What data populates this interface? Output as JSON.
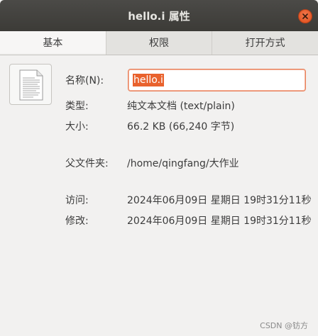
{
  "window": {
    "title": "hello.i 属性"
  },
  "tabs": [
    {
      "label": "基本"
    },
    {
      "label": "权限"
    },
    {
      "label": "打开方式"
    }
  ],
  "basic": {
    "name_label": "名称(N):",
    "name_value": "hello.i",
    "type_label": "类型:",
    "type_value": "纯文本文档 (text/plain)",
    "size_label": "大小:",
    "size_value": "66.2 KB (66,240 字节)",
    "parent_label": "父文件夹:",
    "parent_value": "/home/qingfang/大作业",
    "accessed_label": "访问:",
    "accessed_value": "2024年06月09日 星期日 19时31分11秒",
    "modified_label": "修改:",
    "modified_value": "2024年06月09日 星期日 19时31分11秒"
  },
  "watermark": "CSDN @钫方",
  "colors": {
    "accent": "#e9622d",
    "titlebar": "#3c3b37",
    "background": "#f2f1f0"
  },
  "icons": {
    "close": "close-icon",
    "file": "text-document-icon"
  }
}
